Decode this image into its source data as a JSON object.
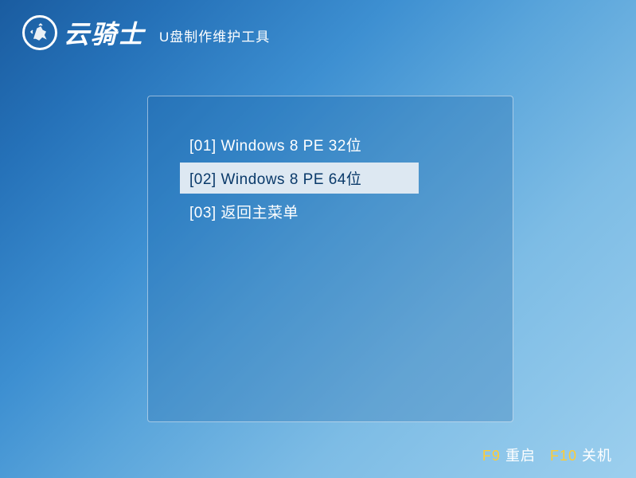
{
  "header": {
    "brand": "云骑士",
    "subtitle": "U盘制作维护工具"
  },
  "menu": {
    "items": [
      {
        "label": "[01] Windows 8 PE 32位",
        "selected": false
      },
      {
        "label": "[02] Windows 8 PE 64位",
        "selected": true
      },
      {
        "label": "[03] 返回主菜单",
        "selected": false
      }
    ]
  },
  "footer": {
    "restart_key": "F9",
    "restart_label": "重启",
    "shutdown_key": "F10",
    "shutdown_label": "关机"
  }
}
